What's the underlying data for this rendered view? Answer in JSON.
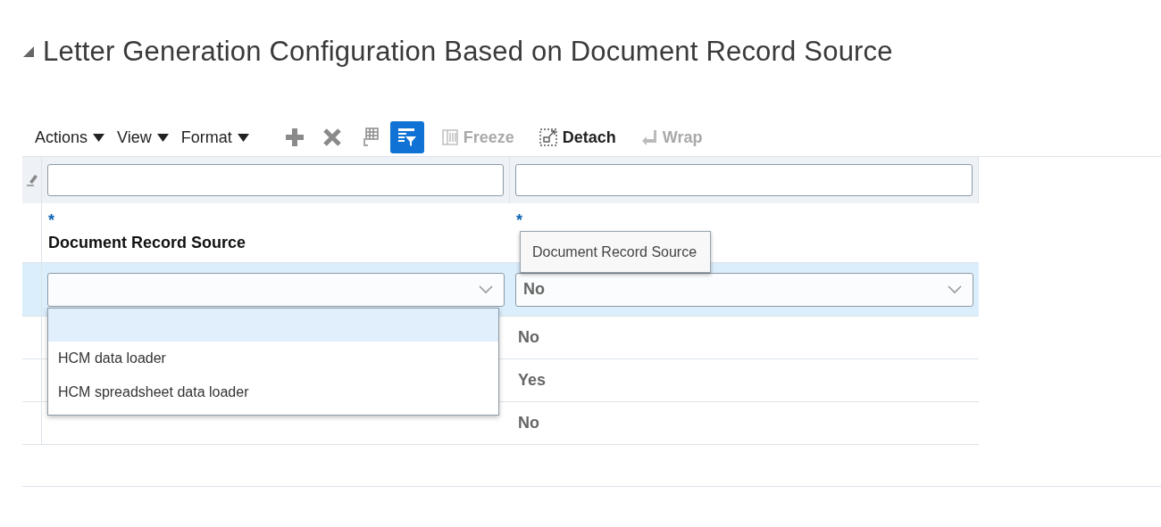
{
  "section": {
    "title": "Letter Generation Configuration Based on Document Record Source",
    "expanded": true
  },
  "toolbar": {
    "menus": [
      {
        "label": "Actions"
      },
      {
        "label": "View"
      },
      {
        "label": "Format"
      }
    ],
    "icon_buttons": [
      {
        "kind": "add",
        "selected": false
      },
      {
        "kind": "delete",
        "selected": false
      },
      {
        "kind": "grid",
        "selected": false
      },
      {
        "kind": "filter",
        "selected": true
      }
    ],
    "text_buttons": [
      {
        "kind": "freeze",
        "label": "Freeze",
        "disabled": true
      },
      {
        "kind": "detach",
        "label": "Detach",
        "disabled": false
      },
      {
        "kind": "wrap",
        "label": "Wrap",
        "disabled": true
      }
    ]
  },
  "table": {
    "columns": [
      {
        "label": "Document Record Source",
        "required_mark": "*"
      },
      {
        "required_mark": "*"
      }
    ],
    "rows": [
      {
        "selected": true,
        "kind": "edit",
        "column_2": "No"
      },
      {
        "selected": false,
        "kind": "read",
        "column_2": "No"
      },
      {
        "selected": false,
        "kind": "read",
        "column_2": "Yes"
      },
      {
        "selected": false,
        "kind": "read",
        "column_2": "No"
      }
    ]
  },
  "dropdown": {
    "options": [
      {
        "kind": "blank",
        "selected": true
      },
      {
        "kind": "option",
        "label": "HCM data loader",
        "selected": false
      },
      {
        "kind": "option",
        "label": "HCM spreadsheet data loader",
        "selected": false
      }
    ]
  },
  "tooltip": {
    "text": "Document Record Source"
  }
}
